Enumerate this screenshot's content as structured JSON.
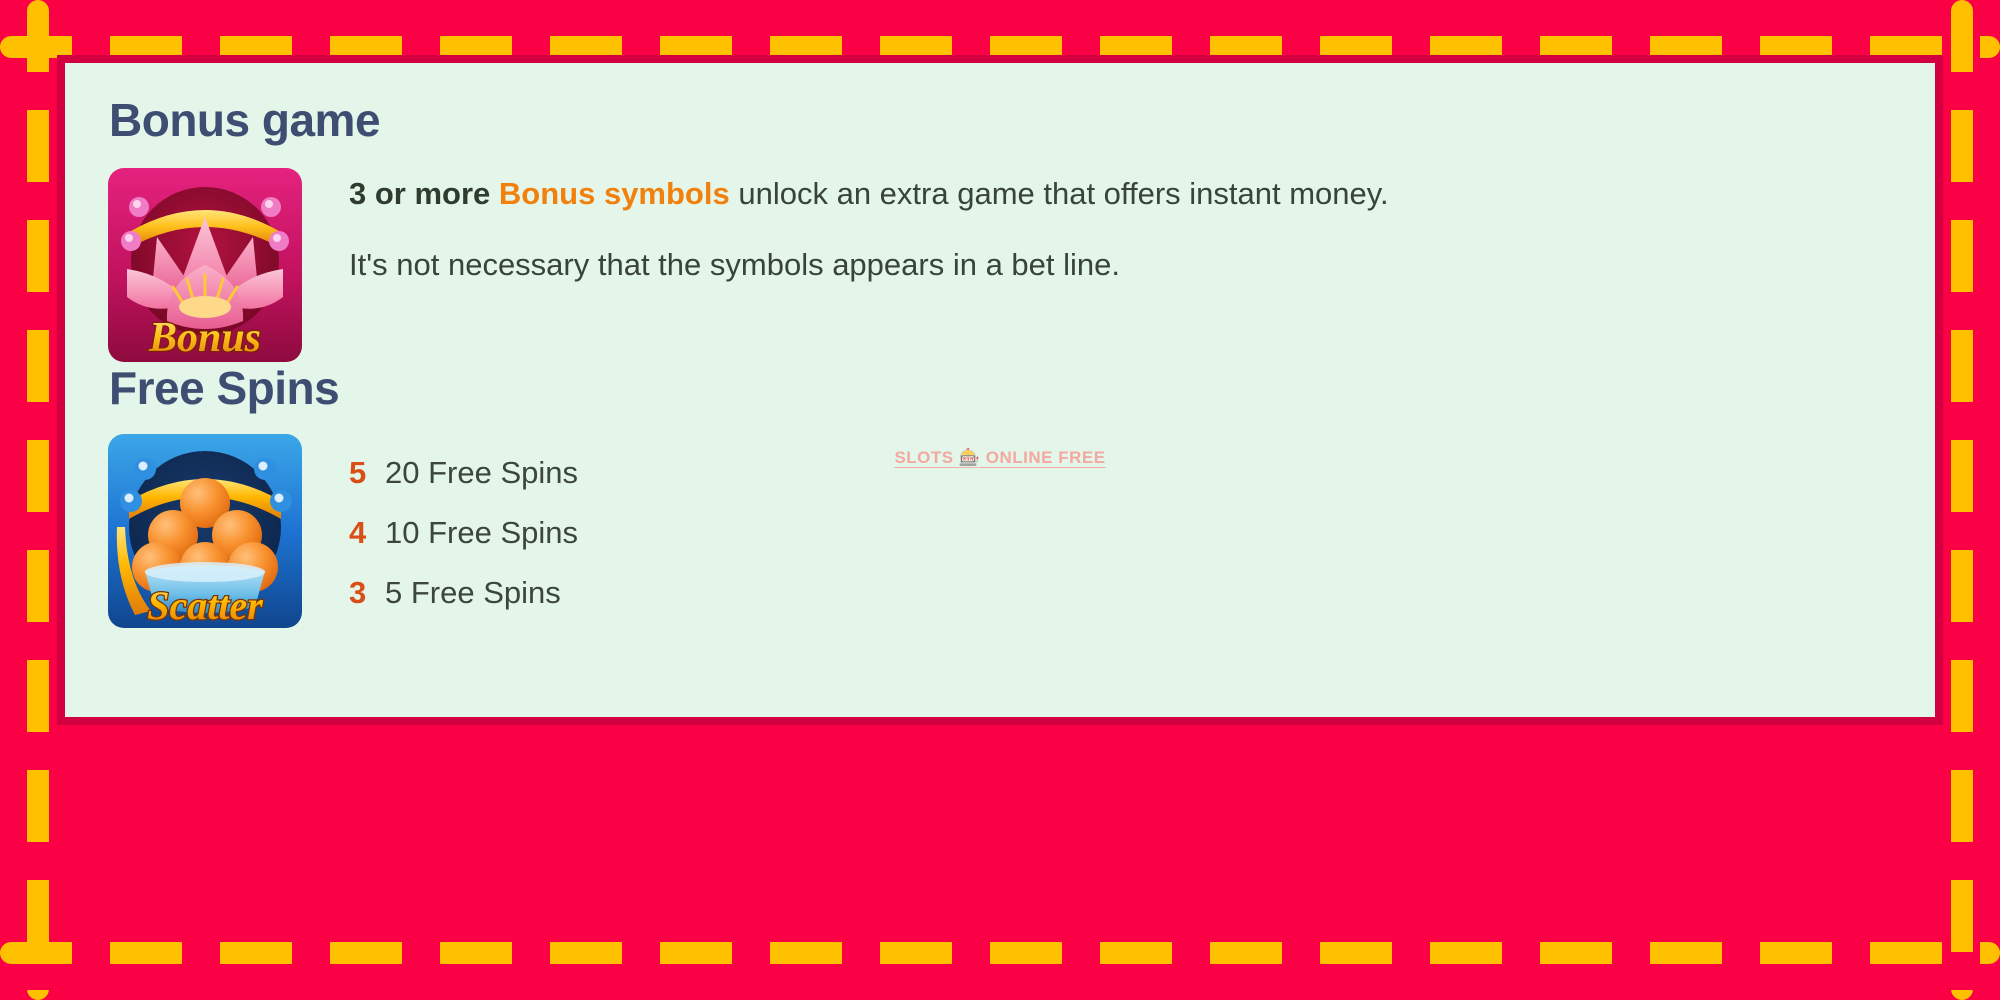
{
  "frame": {
    "background_color": "#FA0145",
    "dash_color": "#FFC000",
    "card_border_color": "#D20040",
    "card_background_color": "#E4F6E9"
  },
  "bonus_section": {
    "heading": "Bonus game",
    "icon": {
      "name": "bonus-lotus-symbol",
      "label": "Bonus",
      "label_color": "#FFC21A",
      "frame_color": "#D6157A",
      "flower_color": "#F48FB1"
    },
    "lines": [
      {
        "id": "bonus-rule-line",
        "lead_bold": "3 or more",
        "accent": "Bonus symbols",
        "accent_color": "#F2800D",
        "tail": "unlock an extra game that offers instant money."
      },
      {
        "id": "bonus-note-line",
        "text": "It's not necessary that the symbols appears in a bet line."
      }
    ]
  },
  "watermark": {
    "text_left": "SLOTS",
    "emoji": "🎰",
    "emoji_name": "slot-machine-icon",
    "text_right": "ONLINE FREE",
    "color": "#F3A9A0"
  },
  "free_spins_section": {
    "heading": "Free Spins",
    "icon": {
      "name": "scatter-bowl-symbol",
      "label": "Scatter",
      "label_color": "#FFB400",
      "frame_color": "#1E73D2",
      "ball_color": "#F78A2E"
    },
    "count_color": "#D94E17",
    "rows": [
      {
        "count": "5",
        "label": "20 Free Spins"
      },
      {
        "count": "4",
        "label": "10 Free Spins"
      },
      {
        "count": "3",
        "label": "5 Free Spins"
      }
    ]
  }
}
